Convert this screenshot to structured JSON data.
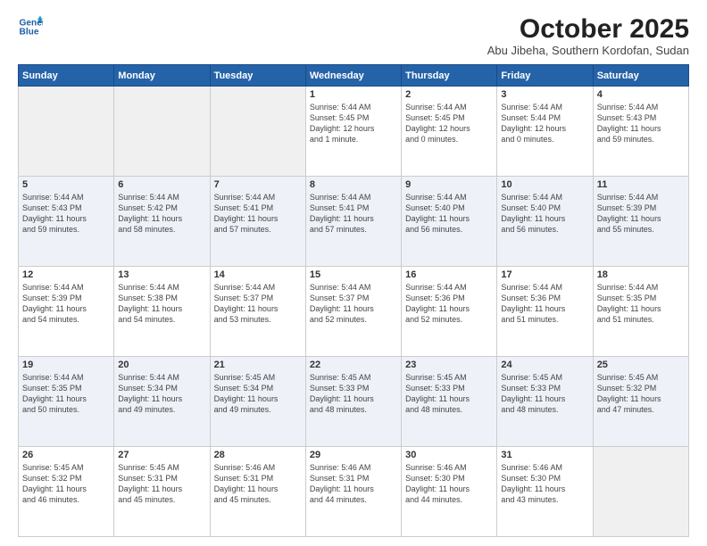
{
  "header": {
    "logo_line1": "General",
    "logo_line2": "Blue",
    "month": "October 2025",
    "location": "Abu Jibeha, Southern Kordofan, Sudan"
  },
  "days_of_week": [
    "Sunday",
    "Monday",
    "Tuesday",
    "Wednesday",
    "Thursday",
    "Friday",
    "Saturday"
  ],
  "weeks": [
    [
      {
        "day": "",
        "content": ""
      },
      {
        "day": "",
        "content": ""
      },
      {
        "day": "",
        "content": ""
      },
      {
        "day": "1",
        "content": "Sunrise: 5:44 AM\nSunset: 5:45 PM\nDaylight: 12 hours\nand 1 minute."
      },
      {
        "day": "2",
        "content": "Sunrise: 5:44 AM\nSunset: 5:45 PM\nDaylight: 12 hours\nand 0 minutes."
      },
      {
        "day": "3",
        "content": "Sunrise: 5:44 AM\nSunset: 5:44 PM\nDaylight: 12 hours\nand 0 minutes."
      },
      {
        "day": "4",
        "content": "Sunrise: 5:44 AM\nSunset: 5:43 PM\nDaylight: 11 hours\nand 59 minutes."
      }
    ],
    [
      {
        "day": "5",
        "content": "Sunrise: 5:44 AM\nSunset: 5:43 PM\nDaylight: 11 hours\nand 59 minutes."
      },
      {
        "day": "6",
        "content": "Sunrise: 5:44 AM\nSunset: 5:42 PM\nDaylight: 11 hours\nand 58 minutes."
      },
      {
        "day": "7",
        "content": "Sunrise: 5:44 AM\nSunset: 5:41 PM\nDaylight: 11 hours\nand 57 minutes."
      },
      {
        "day": "8",
        "content": "Sunrise: 5:44 AM\nSunset: 5:41 PM\nDaylight: 11 hours\nand 57 minutes."
      },
      {
        "day": "9",
        "content": "Sunrise: 5:44 AM\nSunset: 5:40 PM\nDaylight: 11 hours\nand 56 minutes."
      },
      {
        "day": "10",
        "content": "Sunrise: 5:44 AM\nSunset: 5:40 PM\nDaylight: 11 hours\nand 56 minutes."
      },
      {
        "day": "11",
        "content": "Sunrise: 5:44 AM\nSunset: 5:39 PM\nDaylight: 11 hours\nand 55 minutes."
      }
    ],
    [
      {
        "day": "12",
        "content": "Sunrise: 5:44 AM\nSunset: 5:39 PM\nDaylight: 11 hours\nand 54 minutes."
      },
      {
        "day": "13",
        "content": "Sunrise: 5:44 AM\nSunset: 5:38 PM\nDaylight: 11 hours\nand 54 minutes."
      },
      {
        "day": "14",
        "content": "Sunrise: 5:44 AM\nSunset: 5:37 PM\nDaylight: 11 hours\nand 53 minutes."
      },
      {
        "day": "15",
        "content": "Sunrise: 5:44 AM\nSunset: 5:37 PM\nDaylight: 11 hours\nand 52 minutes."
      },
      {
        "day": "16",
        "content": "Sunrise: 5:44 AM\nSunset: 5:36 PM\nDaylight: 11 hours\nand 52 minutes."
      },
      {
        "day": "17",
        "content": "Sunrise: 5:44 AM\nSunset: 5:36 PM\nDaylight: 11 hours\nand 51 minutes."
      },
      {
        "day": "18",
        "content": "Sunrise: 5:44 AM\nSunset: 5:35 PM\nDaylight: 11 hours\nand 51 minutes."
      }
    ],
    [
      {
        "day": "19",
        "content": "Sunrise: 5:44 AM\nSunset: 5:35 PM\nDaylight: 11 hours\nand 50 minutes."
      },
      {
        "day": "20",
        "content": "Sunrise: 5:44 AM\nSunset: 5:34 PM\nDaylight: 11 hours\nand 49 minutes."
      },
      {
        "day": "21",
        "content": "Sunrise: 5:45 AM\nSunset: 5:34 PM\nDaylight: 11 hours\nand 49 minutes."
      },
      {
        "day": "22",
        "content": "Sunrise: 5:45 AM\nSunset: 5:33 PM\nDaylight: 11 hours\nand 48 minutes."
      },
      {
        "day": "23",
        "content": "Sunrise: 5:45 AM\nSunset: 5:33 PM\nDaylight: 11 hours\nand 48 minutes."
      },
      {
        "day": "24",
        "content": "Sunrise: 5:45 AM\nSunset: 5:33 PM\nDaylight: 11 hours\nand 48 minutes."
      },
      {
        "day": "25",
        "content": "Sunrise: 5:45 AM\nSunset: 5:32 PM\nDaylight: 11 hours\nand 47 minutes."
      }
    ],
    [
      {
        "day": "26",
        "content": "Sunrise: 5:45 AM\nSunset: 5:32 PM\nDaylight: 11 hours\nand 46 minutes."
      },
      {
        "day": "27",
        "content": "Sunrise: 5:45 AM\nSunset: 5:31 PM\nDaylight: 11 hours\nand 45 minutes."
      },
      {
        "day": "28",
        "content": "Sunrise: 5:46 AM\nSunset: 5:31 PM\nDaylight: 11 hours\nand 45 minutes."
      },
      {
        "day": "29",
        "content": "Sunrise: 5:46 AM\nSunset: 5:31 PM\nDaylight: 11 hours\nand 44 minutes."
      },
      {
        "day": "30",
        "content": "Sunrise: 5:46 AM\nSunset: 5:30 PM\nDaylight: 11 hours\nand 44 minutes."
      },
      {
        "day": "31",
        "content": "Sunrise: 5:46 AM\nSunset: 5:30 PM\nDaylight: 11 hours\nand 43 minutes."
      },
      {
        "day": "",
        "content": ""
      }
    ]
  ]
}
